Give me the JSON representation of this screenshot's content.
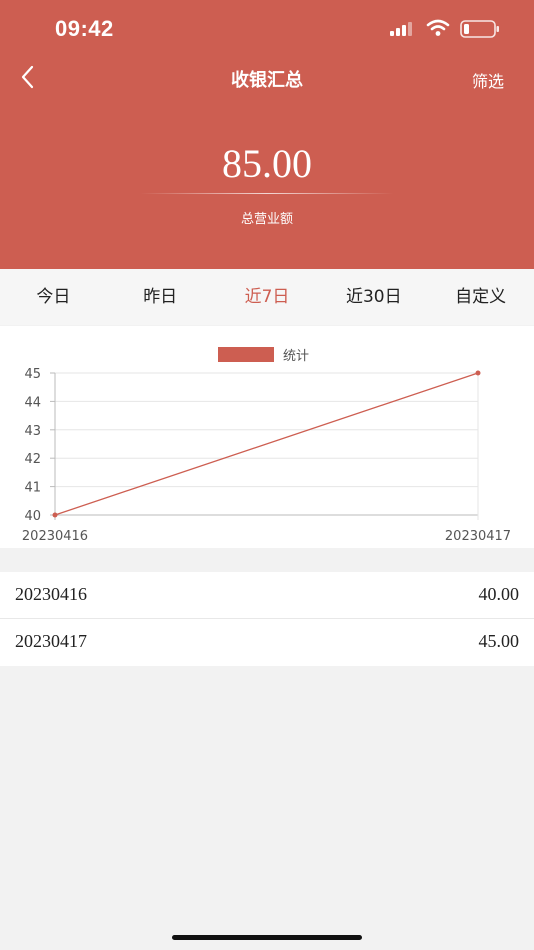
{
  "status_bar": {
    "time": "09:42"
  },
  "nav": {
    "title": "收银汇总",
    "filter_label": "筛选"
  },
  "summary": {
    "total": "85.00",
    "label": "总营业额"
  },
  "tabs": [
    {
      "label": "今日",
      "active": false
    },
    {
      "label": "昨日",
      "active": false
    },
    {
      "label": "近7日",
      "active": true
    },
    {
      "label": "近30日",
      "active": false
    },
    {
      "label": "自定义",
      "active": false
    }
  ],
  "chart_data": {
    "type": "line",
    "x": [
      "20230416",
      "20230417"
    ],
    "series": [
      {
        "name": "统计",
        "values": [
          40,
          45
        ],
        "color": "#cd5e51"
      }
    ],
    "ylim": [
      40,
      45
    ],
    "yticks": [
      40,
      41,
      42,
      43,
      44,
      45
    ],
    "legend_position": "top-center",
    "grid": true
  },
  "records": [
    {
      "date": "20230416",
      "amount": "40.00"
    },
    {
      "date": "20230417",
      "amount": "45.00"
    }
  ],
  "colors": {
    "primary": "#cd5e51"
  }
}
